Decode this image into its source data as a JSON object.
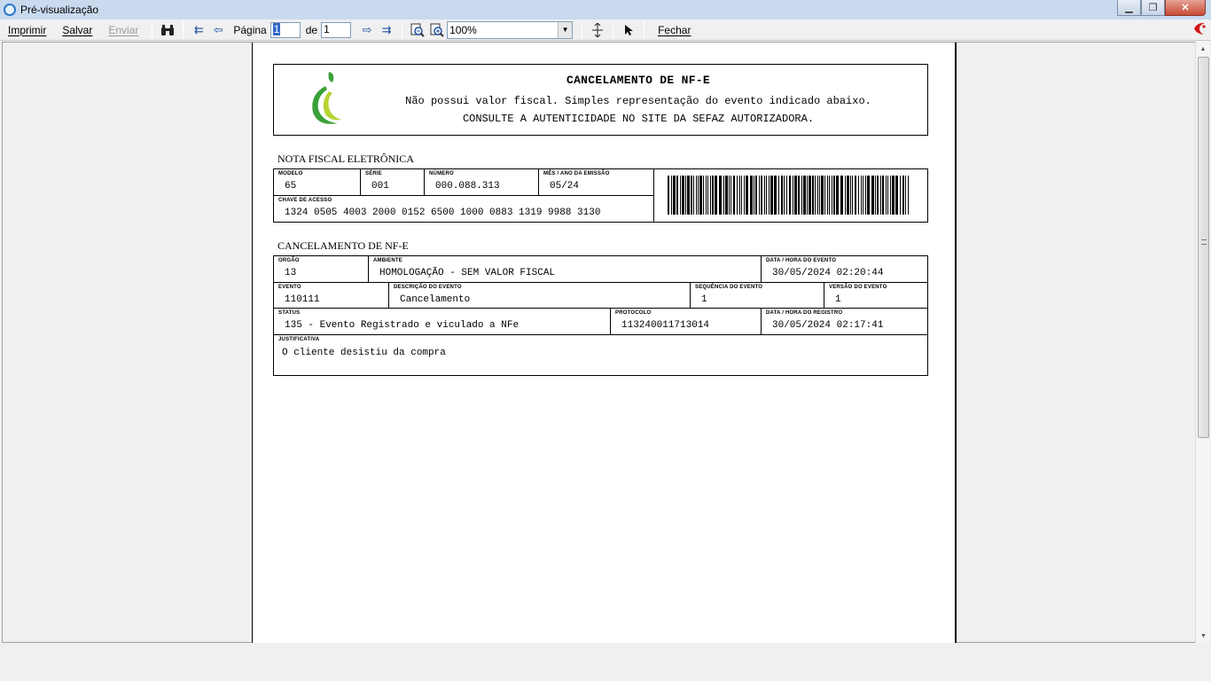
{
  "window": {
    "title": "Pré-visualização"
  },
  "toolbar": {
    "print": "Imprimir",
    "save": "Salvar",
    "send": "Enviar",
    "page_label": "Página",
    "page_current": "1",
    "of_label": "de",
    "page_total": "1",
    "zoom": "100%",
    "close": "Fechar"
  },
  "doc": {
    "header": {
      "title": "CANCELAMENTO DE NF-E",
      "line1": "Não possui valor fiscal. Simples representação do evento indicado abaixo.",
      "line2": "CONSULTE A AUTENTICIDADE NO SITE DA SEFAZ AUTORIZADORA."
    },
    "nfe": {
      "section": "NOTA FISCAL ELETRÔNICA",
      "modelo_label": "MODELO",
      "modelo": "65",
      "serie_label": "SÉRIE",
      "serie": "001",
      "numero_label": "NÚMERO",
      "numero": "000.088.313",
      "emissao_label": "MÊS / ANO DA EMISSÃO",
      "emissao": "05/24",
      "chave_label": "CHAVE DE ACESSO",
      "chave": "1324 0505 4003 2000 0152 6500 1000 0883 1319 9988 3130"
    },
    "evento": {
      "section": "CANCELAMENTO DE NF-E",
      "orgao_label": "ORGÃO",
      "orgao": "13",
      "ambiente_label": "AMBIENTE",
      "ambiente": "HOMOLOGAÇÃO - SEM VALOR FISCAL",
      "datahora_label": "DATA / HORA DO EVENTO",
      "datahora": "30/05/2024 02:20:44",
      "evento_label": "EVENTO",
      "evento": "110111",
      "descricao_label": "DESCRIÇÃO DO EVENTO",
      "descricao": "Cancelamento",
      "sequencia_label": "SEQUÊNCIA DO EVENTO",
      "sequencia": "1",
      "versao_label": "VERSÃO DO EVENTO",
      "versao": "1",
      "status_label": "STATUS",
      "status": "135 - Evento Registrado e viculado a NFe",
      "protocolo_label": "PROTOCOLO",
      "protocolo": "113240011713014",
      "registro_label": "DATA / HORA DO REGISTRO",
      "registro": "30/05/2024 02:17:41",
      "justificativa_label": "JUSTIFICATIVA",
      "justificativa": "O cliente desistiu da compra"
    }
  },
  "colors": {
    "logo_green": "#3aa13a",
    "logo_lime": "#b6d432",
    "brand_red": "#d01818"
  }
}
